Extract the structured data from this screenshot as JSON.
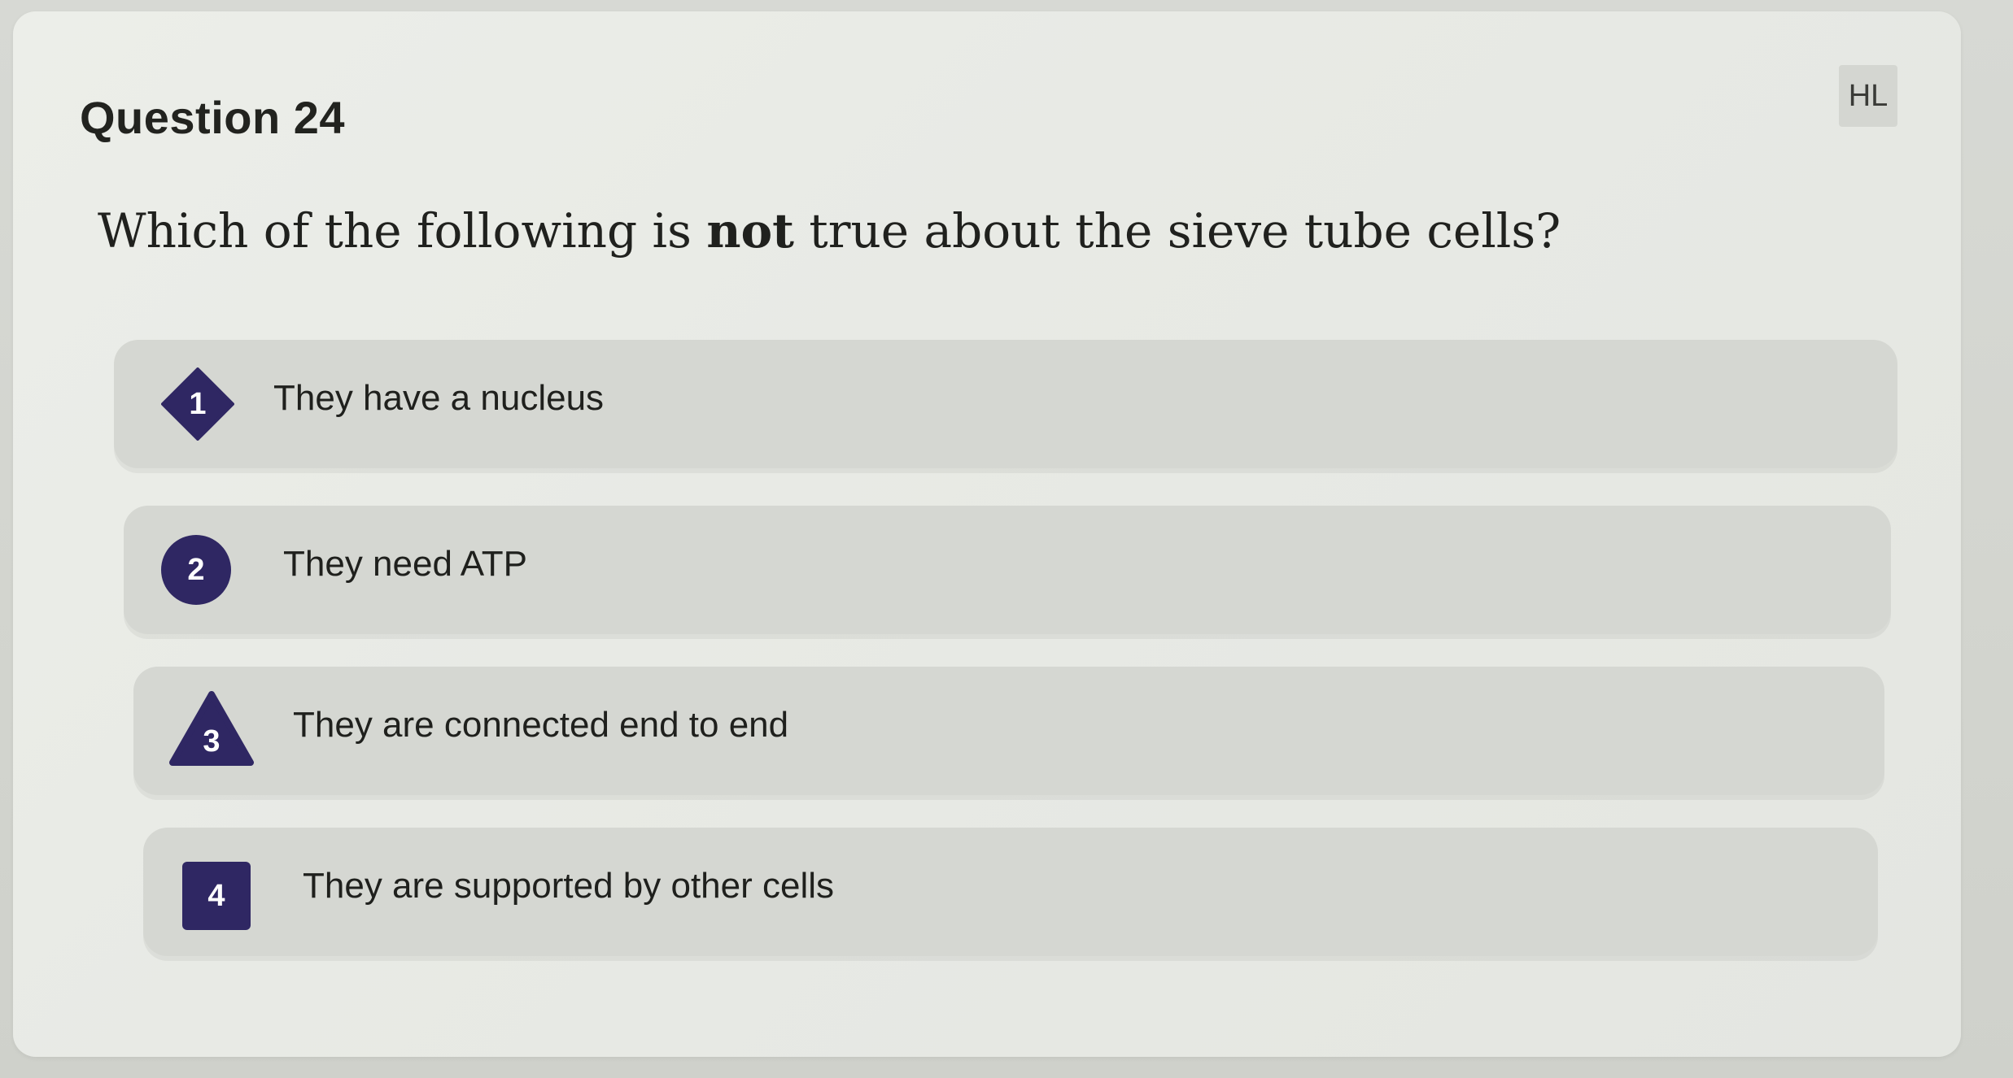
{
  "question": {
    "header": "Question 24",
    "level_badge": "HL",
    "text_before": "Which of the following is ",
    "text_emphasis": "not",
    "text_after": " true about the sieve tube cells?"
  },
  "options": [
    {
      "number": "1",
      "shape": "diamond-icon",
      "label": "They have a nucleus"
    },
    {
      "number": "2",
      "shape": "circle-icon",
      "label": "They need ATP"
    },
    {
      "number": "3",
      "shape": "triangle-icon",
      "label": "They are connected end to end"
    },
    {
      "number": "4",
      "shape": "square-icon",
      "label": "They are supported by other cells"
    }
  ],
  "colors": {
    "marker": "#2f2763",
    "option_background": "#d5d7d2",
    "card_background": "#eceee9"
  }
}
